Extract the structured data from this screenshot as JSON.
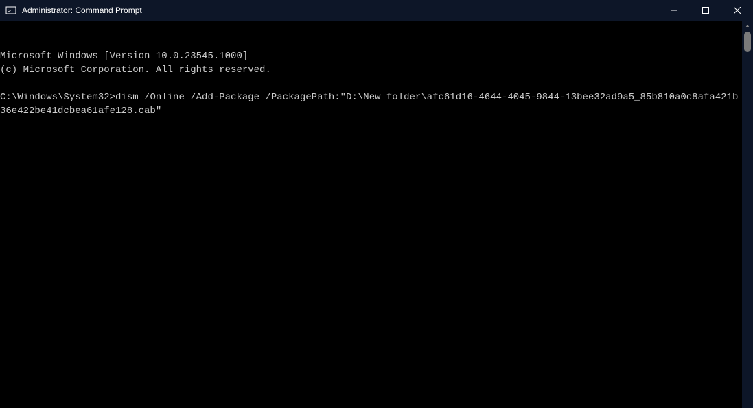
{
  "titlebar": {
    "title": "Administrator: Command Prompt"
  },
  "terminal": {
    "line1": "Microsoft Windows [Version 10.0.23545.1000]",
    "line2": "(c) Microsoft Corporation. All rights reserved.",
    "blank": "",
    "prompt": "C:\\Windows\\System32>",
    "command": "dism /Online /Add-Package /PackagePath:\"D:\\New folder\\afc61d16-4644-4045-9844-13bee32ad9a5_85b810a0c8afa421b36e422be41dcbea61afe128.cab\""
  }
}
